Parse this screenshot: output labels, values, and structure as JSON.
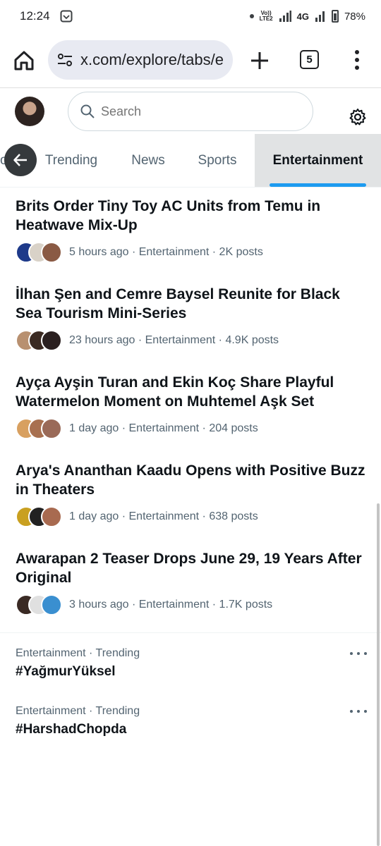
{
  "status_bar": {
    "time": "12:24",
    "volte_line1": "Vo))",
    "volte_line2": "LTE2",
    "network": "4G",
    "battery": "78%"
  },
  "browser": {
    "url": "x.com/explore/tabs/e",
    "tab_count": "5"
  },
  "search": {
    "placeholder": "Search"
  },
  "tabs": [
    {
      "label": "Trending"
    },
    {
      "label": "News"
    },
    {
      "label": "Sports"
    },
    {
      "label": "Entertainment",
      "active": true
    }
  ],
  "trends": [
    {
      "title": "Brits Order Tiny Toy AC Units from Temu in Heatwave Mix-Up",
      "meta": "5 hours ago · Entertainment · 2K posts",
      "avatar_colors": [
        "#1e3a8a",
        "#d9d2c8",
        "#8a5a44"
      ]
    },
    {
      "title": "İlhan Şen and Cemre Baysel Reunite for Black Sea Tourism Mini-Series",
      "meta": "23 hours ago · Entertainment · 4.9K posts",
      "avatar_colors": [
        "#b89070",
        "#3b2a22",
        "#2b2020"
      ]
    },
    {
      "title": "Ayça Ayşin Turan and Ekin Koç Share Playful Watermelon Moment on Muhtemel Aşk Set",
      "meta": "1 day ago · Entertainment · 204 posts",
      "avatar_colors": [
        "#d8a060",
        "#a87050",
        "#9a6a58"
      ]
    },
    {
      "title": "Arya's Ananthan Kaadu Opens with Positive Buzz in Theaters",
      "meta": "1 day ago · Entertainment · 638 posts",
      "avatar_colors": [
        "#c9a020",
        "#222222",
        "#a86a50"
      ]
    },
    {
      "title": "Awarapan 2 Teaser Drops June 29, 19 Years After Original",
      "meta": "3 hours ago · Entertainment · 1.7K posts",
      "avatar_colors": [
        "#3a2a24",
        "#e0e0e0",
        "#3a8fd0"
      ]
    }
  ],
  "hashtags": [
    {
      "context": "Entertainment · Trending",
      "name": "#YağmurYüksel"
    },
    {
      "context": "Entertainment · Trending",
      "name": "#HarshadChopda"
    }
  ],
  "colors": {
    "accent": "#1d9bf0",
    "text_primary": "#0f1419",
    "text_secondary": "#536471",
    "active_tab_bg": "#e1e3e4"
  }
}
